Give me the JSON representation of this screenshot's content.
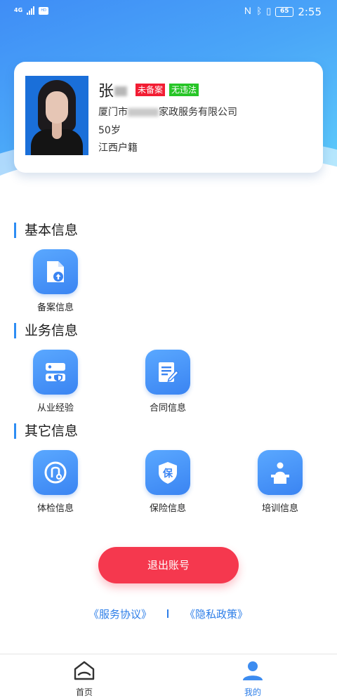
{
  "status_bar": {
    "network": "4G",
    "battery": "65",
    "time": "2:55"
  },
  "profile": {
    "name_visible": "张",
    "tags": [
      "未备案",
      "无违法"
    ],
    "company_prefix": "厦门市",
    "company_suffix": "家政服务有限公司",
    "age": "50岁",
    "hometown": "江西户籍"
  },
  "sections": [
    {
      "title": "基本信息",
      "items": [
        {
          "label": "备案信息",
          "icon": "file-upload-icon"
        }
      ]
    },
    {
      "title": "业务信息",
      "items": [
        {
          "label": "从业经验",
          "icon": "experience-icon"
        },
        {
          "label": "合同信息",
          "icon": "contract-icon"
        }
      ]
    },
    {
      "title": "其它信息",
      "items": [
        {
          "label": "体检信息",
          "icon": "medical-check-icon"
        },
        {
          "label": "保险信息",
          "icon": "insurance-shield-icon"
        },
        {
          "label": "培训信息",
          "icon": "training-icon"
        }
      ]
    }
  ],
  "logout_label": "退出账号",
  "links": {
    "service": "《服务协议》",
    "privacy": "《隐私政策》"
  },
  "bottom_nav": [
    {
      "label": "首页",
      "icon": "home-icon",
      "color": "#333333"
    },
    {
      "label": "我的",
      "icon": "user-icon",
      "color": "#2d7ee8"
    }
  ]
}
